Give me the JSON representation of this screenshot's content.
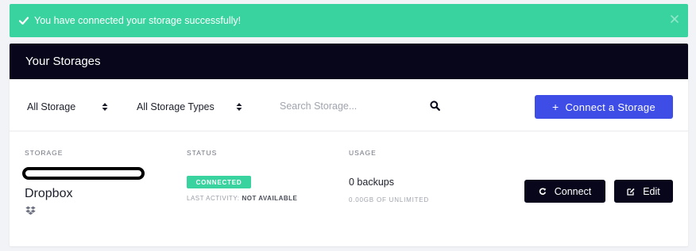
{
  "alert": {
    "message": "You have connected your storage successfully!",
    "icon": "check-icon",
    "close_icon": "close-icon",
    "color": "#39d39f"
  },
  "panel": {
    "title": "Your Storages",
    "header_color": "#07061b"
  },
  "filters": {
    "storage_select": "All Storage",
    "type_select": "All Storage Types",
    "search_placeholder": "Search Storage...",
    "search_value": "",
    "connect_button": "Connect a Storage",
    "connect_button_icon": "+",
    "accent_color": "#3d4de6"
  },
  "table": {
    "headers": {
      "storage": "STORAGE",
      "status": "STATUS",
      "usage": "USAGE"
    },
    "rows": [
      {
        "name": "Dropbox",
        "icon": "dropbox-icon",
        "status_badge": "CONNECTED",
        "last_activity_label": "LAST ACTIVITY:",
        "last_activity_value": "NOT AVAILABLE",
        "backups": "0 backups",
        "usage_detail": "0.00GB OF UNLIMITED",
        "connect_label": "Connect",
        "connect_icon": "refresh-icon",
        "edit_label": "Edit",
        "edit_icon": "edit-icon"
      }
    ]
  }
}
